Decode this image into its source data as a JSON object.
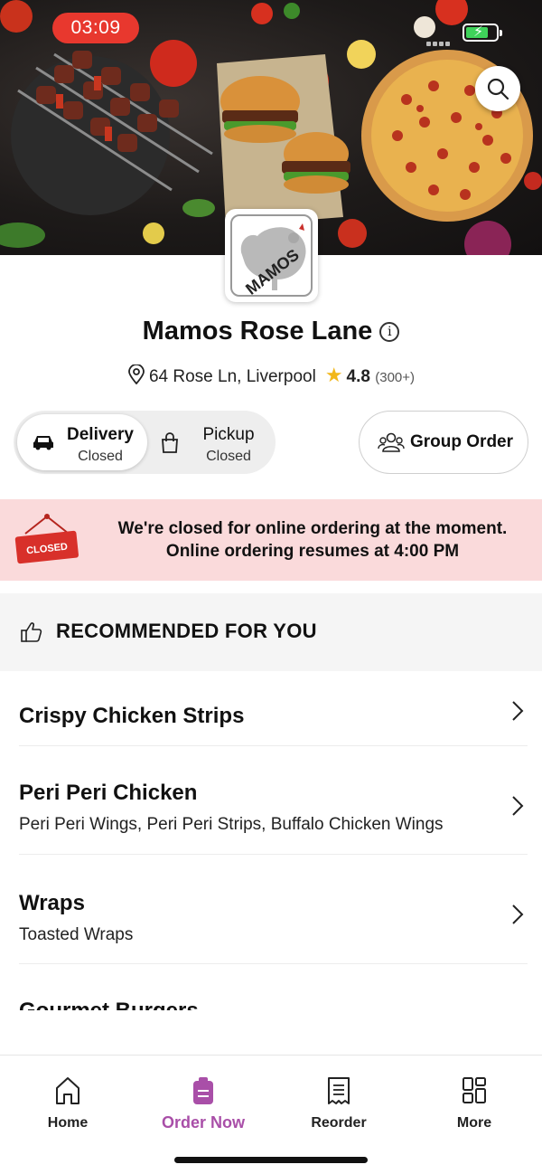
{
  "status_bar": {
    "time": "03:09",
    "battery_color": "#3fd35a",
    "time_pill_color": "#e8382e"
  },
  "hero": {
    "description_icons": [
      "search-icon"
    ]
  },
  "store": {
    "logo_text": "MAMOS",
    "name": "Mamos Rose Lane",
    "address": "64 Rose Ln, Liverpool",
    "rating": "4.8",
    "rating_count": "(300+)"
  },
  "order_mode": {
    "delivery": {
      "label": "Delivery",
      "status": "Closed",
      "selected": true
    },
    "pickup": {
      "label": "Pickup",
      "status": "Closed",
      "selected": false
    },
    "group_order_label": "Group Order"
  },
  "closed_banner": {
    "sign_text": "CLOSED",
    "line1": "We're closed for online ordering at the moment.",
    "line2": "Online ordering resumes at 4:00 PM",
    "background": "#fadadb"
  },
  "recommended": {
    "title": "RECOMMENDED FOR YOU"
  },
  "categories": [
    {
      "name": "Crispy Chicken Strips",
      "description": ""
    },
    {
      "name": "Peri Peri Chicken",
      "description": "Peri Peri Wings, Peri Peri Strips, Buffalo Chicken Wings"
    },
    {
      "name": "Wraps",
      "description": "Toasted Wraps"
    },
    {
      "name": "Gourmet Burgers",
      "description": ""
    }
  ],
  "bottom_nav": {
    "items": [
      {
        "label": "Home",
        "icon": "home-icon"
      },
      {
        "label": "Order Now",
        "icon": "order-icon",
        "active": true
      },
      {
        "label": "Reorder",
        "icon": "receipt-icon"
      },
      {
        "label": "More",
        "icon": "grid-icon"
      }
    ],
    "active_color": "#a94fa8"
  }
}
